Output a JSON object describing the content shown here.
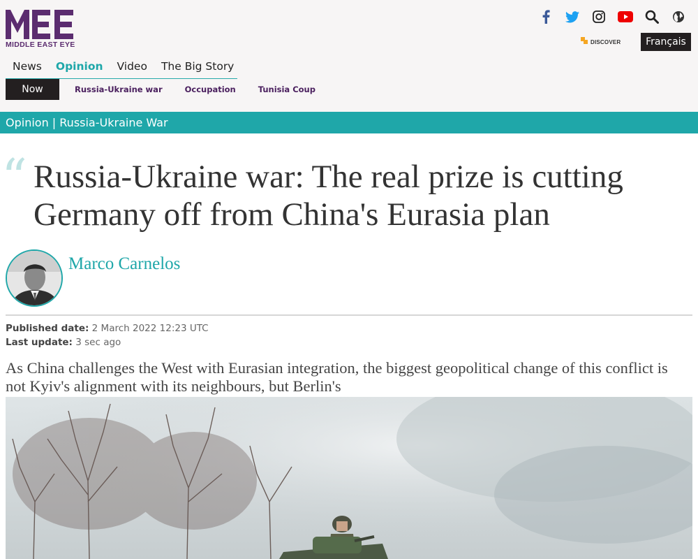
{
  "brand": {
    "name": "MIDDLE EAST EYE",
    "color": "#5b2c6f"
  },
  "header": {
    "discover_label": "DISCOVER",
    "language_button": "Français",
    "social_icons": [
      "facebook-icon",
      "twitter-icon",
      "instagram-icon",
      "youtube-icon",
      "search-icon",
      "globe-icon"
    ]
  },
  "main_nav": {
    "items": [
      "News",
      "Opinion",
      "Video",
      "The Big Story"
    ],
    "active": "Opinion"
  },
  "sub_nav": {
    "now": "Now",
    "tags": [
      "Russia-Ukraine war",
      "Occupation",
      "Tunisia Coup"
    ]
  },
  "section": {
    "label": "Opinion | Russia-Ukraine War",
    "color": "#1fa7a9"
  },
  "article": {
    "headline": "Russia-Ukraine war: The real prize is cutting Germany off from China's Eurasia plan",
    "author": "Marco Carnelos",
    "published_label": "Published date:",
    "published_value": "2 March 2022 12:23 UTC",
    "updated_label": "Last update:",
    "updated_value": "3 sec ago",
    "standfirst": "As China challenges the West with Eurasian integration, the biggest geopolitical change of this conflict is not Kyiv's alignment with its neighbours, but Berlin's"
  }
}
